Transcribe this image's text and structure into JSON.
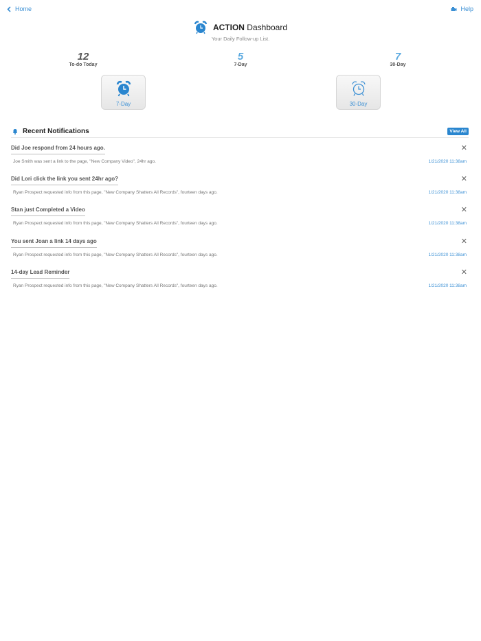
{
  "nav": {
    "home_label": "Home",
    "help_label": "Help"
  },
  "header": {
    "title_bold": "ACTION",
    "title_rest": " Dashboard",
    "subtitle": "Your Daily Follow-up List."
  },
  "stats": [
    {
      "value": "12",
      "label": "To-do Today",
      "color": "#555555"
    },
    {
      "value": "5",
      "label": "7-Day",
      "color": "#5aa9e0"
    },
    {
      "value": "7",
      "label": "30-Day",
      "color": "#5aa9e0"
    }
  ],
  "tiles": [
    {
      "label": "7-Day",
      "icon": "alarm-clock-filled-icon"
    },
    {
      "label": "30-Day",
      "icon": "alarm-clock-outline-icon"
    }
  ],
  "notifications_section": {
    "title": "Recent Notifications",
    "view_all_label": "View All",
    "items": [
      {
        "heading": "Did Joe respond from 24 hours ago.",
        "text": "Joe Smith was sent a link to the page, \"New Company Video\", 24hr ago.",
        "time": "1/21/2020 11:38am"
      },
      {
        "heading": "Did Lori click the link you sent 24hr ago?",
        "text": "Ryan Prospect requested info from this page, \"New Company Shatters All Records\", fourteen days ago.",
        "time": "1/21/2020 11:38am"
      },
      {
        "heading": "Stan just Completed a Video",
        "text": "Ryan Prospect requested info from this page, \"New Company Shatters All Records\", fourteen days ago.",
        "time": "1/21/2020 11:38am"
      },
      {
        "heading": "You sent Joan a link 14 days ago",
        "text": "Ryan Prospect requested info from this page, \"New Company Shatters All Records\", fourteen days ago.",
        "time": "1/21/2020 11:38am"
      },
      {
        "heading": "14-day Lead Reminder",
        "text": "Ryan Prospect requested info from this page, \"New Company Shatters All Records\", fourteen days ago.",
        "time": "1/21/2020 11:38am"
      }
    ]
  },
  "colors": {
    "accent": "#3a8fd4",
    "badge": "#2a86cf"
  }
}
